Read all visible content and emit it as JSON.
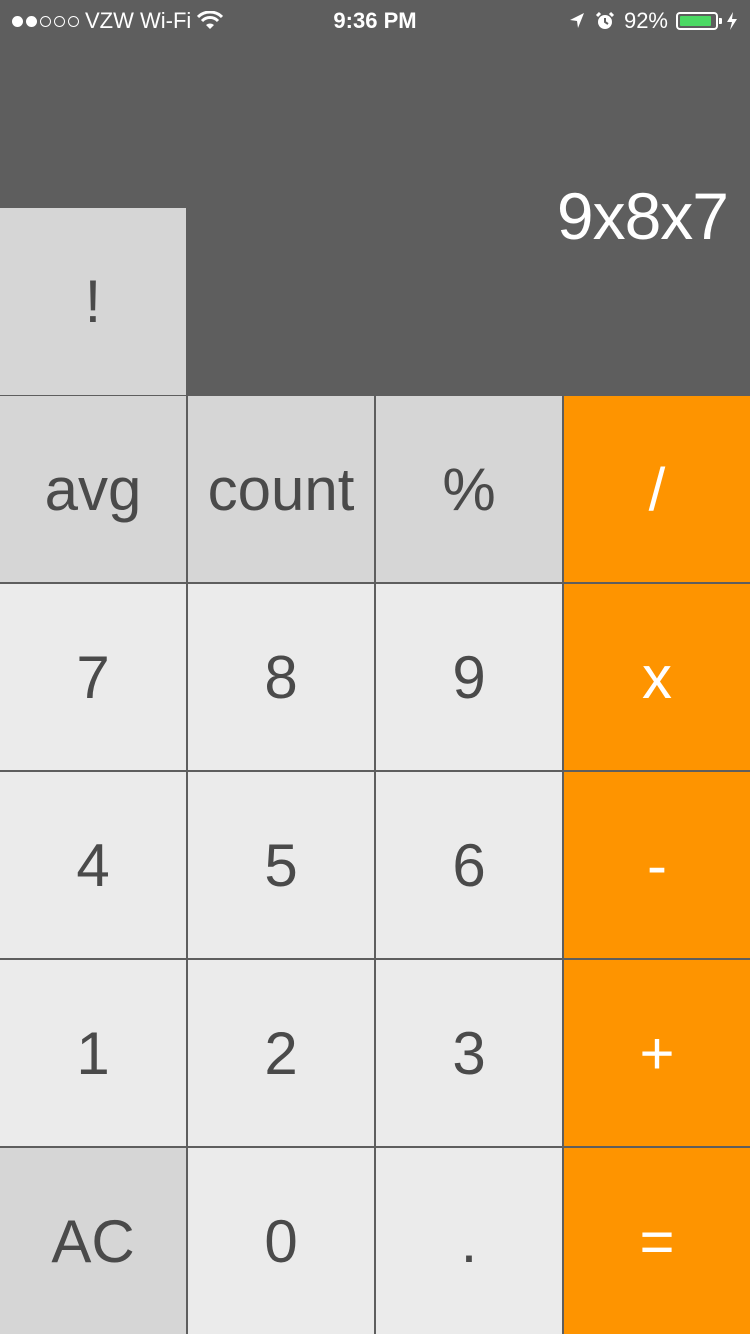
{
  "status_bar": {
    "carrier": "VZW Wi-Fi",
    "time": "9:36 PM",
    "battery": "92%",
    "battery_level": 0.92,
    "signal_bars_filled": 2,
    "signal_bars_total": 5
  },
  "display": {
    "expression": "9x8x7"
  },
  "keys": {
    "factorial": "!",
    "avg": "avg",
    "count": "count",
    "percent": "%",
    "divide": "/",
    "seven": "7",
    "eight": "8",
    "nine": "9",
    "multiply": "x",
    "four": "4",
    "five": "5",
    "six": "6",
    "minus": "-",
    "one": "1",
    "two": "2",
    "three": "3",
    "plus": "+",
    "clear": "AC",
    "zero": "0",
    "decimal": ".",
    "equals": "="
  },
  "colors": {
    "background": "#5e5e5e",
    "function_key": "#d6d6d6",
    "number_key": "#ebebeb",
    "operator_key": "#fe9400",
    "battery_fill": "#4cd964"
  }
}
